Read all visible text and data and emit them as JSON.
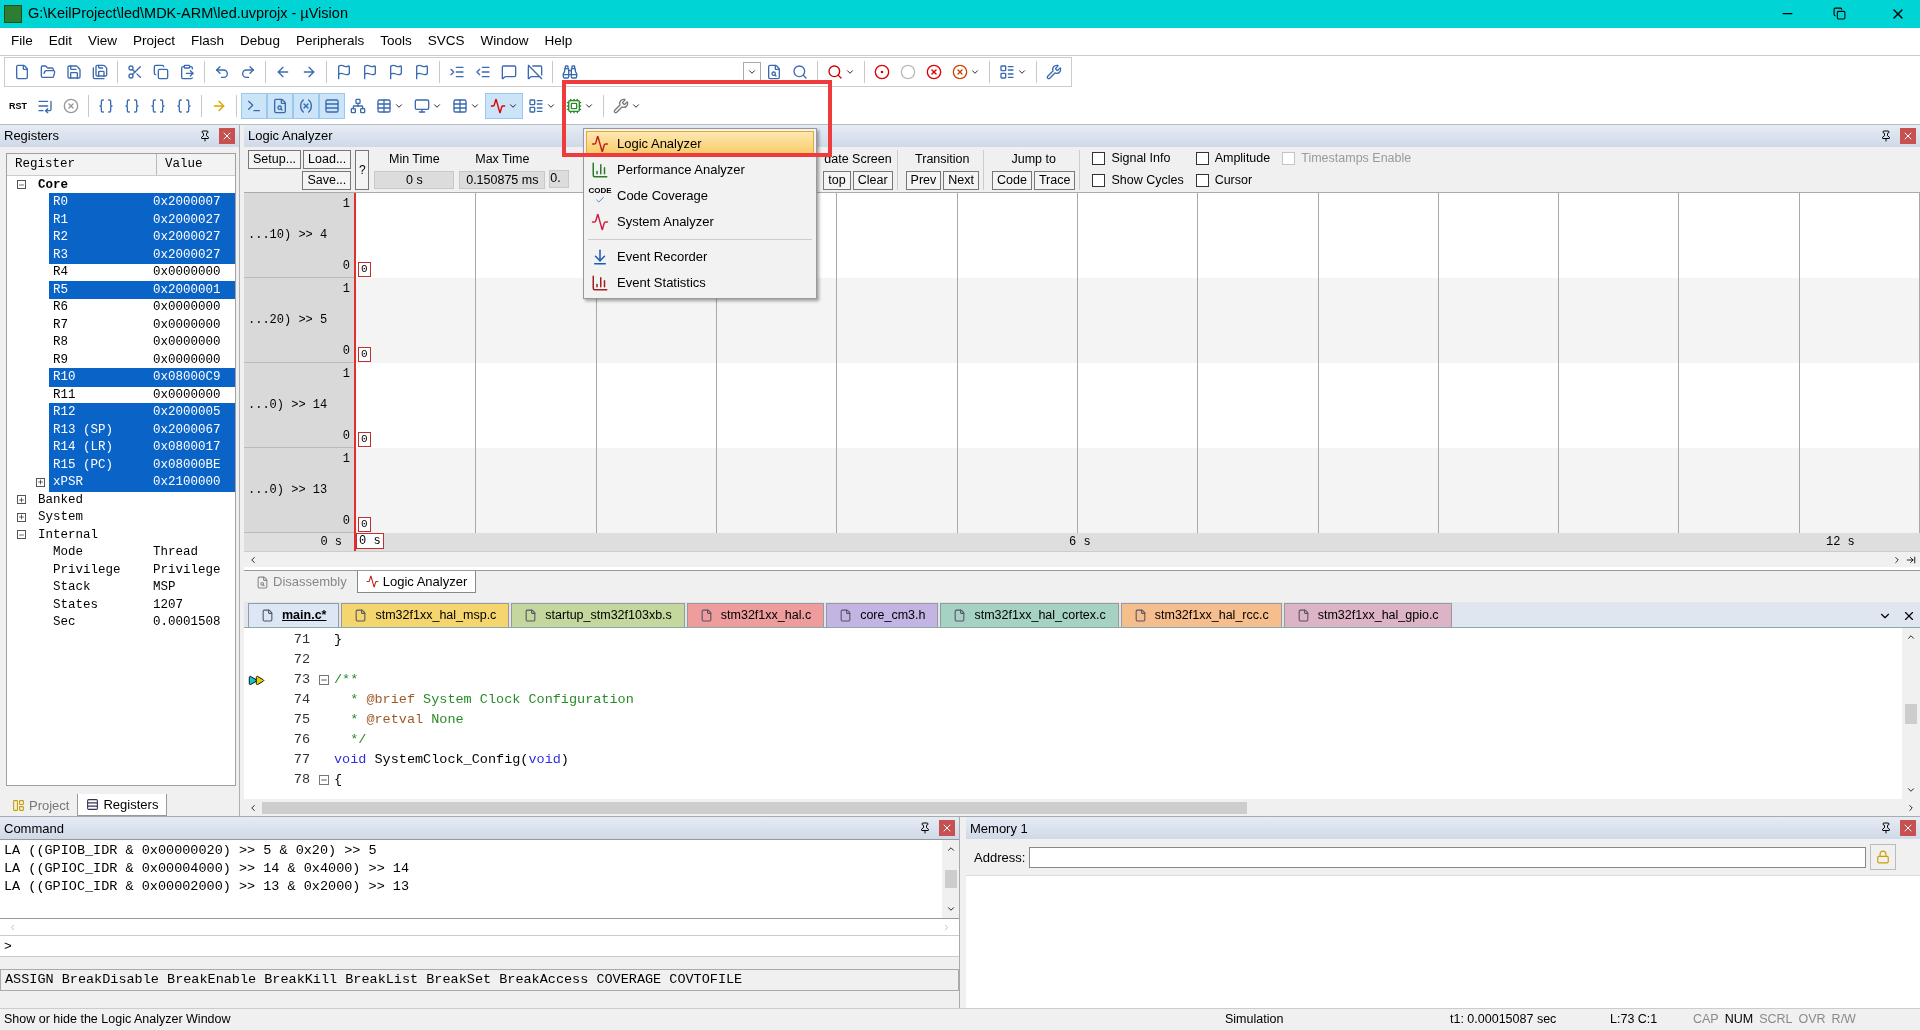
{
  "window": {
    "title": "G:\\KeilProject\\led\\MDK-ARM\\led.uvprojx - µVision"
  },
  "menu": [
    "File",
    "Edit",
    "View",
    "Project",
    "Flash",
    "Debug",
    "Peripherals",
    "Tools",
    "SVCS",
    "Window",
    "Help"
  ],
  "debug_toolbar": [
    {
      "label": "RST",
      "pressed": false
    },
    {
      "pressed": false
    },
    {
      "pressed": false
    },
    {
      "pressed": false
    },
    {
      "pressed": false
    },
    {
      "pressed": false
    },
    {
      "pressed": false
    },
    {
      "pressed": false
    },
    {
      "pressed": true
    },
    {
      "pressed": true
    },
    {
      "pressed": true
    },
    {
      "pressed": true
    },
    {
      "pressed": false
    },
    {
      "pressed": false
    },
    {
      "pressed": false
    },
    {
      "pressed": false
    },
    {
      "pressed": true
    },
    {
      "pressed": false
    },
    {
      "pressed": false
    },
    {
      "pressed": false
    }
  ],
  "registers": {
    "title": "Registers",
    "columns": [
      "Register",
      "Value"
    ],
    "groups": [
      {
        "name": "Core",
        "expanded": true,
        "children": [
          {
            "name": "R0",
            "value": "0x2000007",
            "selected": true,
            "kind": "leaf"
          },
          {
            "name": "R1",
            "value": "0x2000027",
            "selected": true,
            "kind": "leaf"
          },
          {
            "name": "R2",
            "value": "0x2000027",
            "selected": true,
            "kind": "leaf"
          },
          {
            "name": "R3",
            "value": "0x2000027",
            "selected": true,
            "kind": "leaf"
          },
          {
            "name": "R4",
            "value": "0x0000000",
            "selected": false,
            "kind": "leaf"
          },
          {
            "name": "R5",
            "value": "0x2000001",
            "selected": true,
            "kind": "leaf"
          },
          {
            "name": "R6",
            "value": "0x0000000",
            "selected": false,
            "kind": "leaf"
          },
          {
            "name": "R7",
            "value": "0x0000000",
            "selected": false,
            "kind": "leaf"
          },
          {
            "name": "R8",
            "value": "0x0000000",
            "selected": false,
            "kind": "leaf"
          },
          {
            "name": "R9",
            "value": "0x0000000",
            "selected": false,
            "kind": "leaf"
          },
          {
            "name": "R10",
            "value": "0x08000C9",
            "selected": true,
            "kind": "leaf"
          },
          {
            "name": "R11",
            "value": "0x0000000",
            "selected": false,
            "kind": "leaf"
          },
          {
            "name": "R12",
            "value": "0x2000005",
            "selected": true,
            "kind": "leaf"
          },
          {
            "name": "R13 (SP)",
            "value": "0x2000067",
            "selected": true,
            "kind": "leaf"
          },
          {
            "name": "R14 (LR)",
            "value": "0x0800017",
            "selected": true,
            "kind": "leaf"
          },
          {
            "name": "R15 (PC)",
            "value": "0x08000BE",
            "selected": true,
            "kind": "leaf"
          },
          {
            "name": "xPSR",
            "value": "0x2100000",
            "selected": true,
            "kind": "group"
          }
        ]
      },
      {
        "name": "Banked",
        "expanded": false
      },
      {
        "name": "System",
        "expanded": false
      },
      {
        "name": "Internal",
        "expanded": true,
        "children": [
          {
            "name": "Mode",
            "value": "Thread",
            "selected": false,
            "kind": "leaf"
          },
          {
            "name": "Privilege",
            "value": "Privilege",
            "selected": false,
            "kind": "leaf"
          },
          {
            "name": "Stack",
            "value": "MSP",
            "selected": false,
            "kind": "leaf"
          },
          {
            "name": "States",
            "value": "1207",
            "selected": false,
            "kind": "leaf"
          },
          {
            "name": "Sec",
            "value": "0.0001508",
            "selected": false,
            "kind": "leaf"
          }
        ]
      }
    ],
    "tabs": [
      {
        "label": "Project",
        "selected": false
      },
      {
        "label": "Registers",
        "selected": true
      }
    ]
  },
  "logic_analyzer": {
    "title": "Logic Analyzer",
    "buttons": {
      "setup": "Setup...",
      "load": "Load...",
      "save": "Save...",
      "help": "?"
    },
    "min_time": {
      "label": "Min Time",
      "value": "0 s"
    },
    "max_time": {
      "label": "Max Time",
      "value": "0.150875 ms"
    },
    "column_3": {
      "value": "0."
    },
    "update_screen": {
      "label": "date Screen",
      "buttons": [
        "top",
        "Clear"
      ]
    },
    "transition": {
      "label": "Transition",
      "buttons": [
        "Prev",
        "Next"
      ]
    },
    "jump_to": {
      "label": "Jump to",
      "buttons": [
        "Code",
        "Trace"
      ]
    },
    "options": [
      {
        "label": "Signal Info",
        "checked": false,
        "disabled": false
      },
      {
        "label": "Amplitude",
        "checked": false,
        "disabled": false
      },
      {
        "label": "Timestamps Enable",
        "checked": false,
        "disabled": true
      },
      {
        "label": "Show Cycles",
        "checked": false,
        "disabled": false
      },
      {
        "label": "Cursor",
        "checked": false,
        "disabled": false
      }
    ],
    "signals": [
      {
        "label": "...10) >> 4",
        "high": "1",
        "low": "0",
        "marker": "0"
      },
      {
        "label": "...20) >> 5",
        "high": "1",
        "low": "0",
        "marker": "0"
      },
      {
        "label": "...0) >> 14",
        "high": "1",
        "low": "0",
        "marker": "0"
      },
      {
        "label": "...0) >> 13",
        "high": "1",
        "low": "0",
        "marker": "0"
      }
    ],
    "time_axis": {
      "start": "0 s",
      "cursor": "0 s",
      "ticks": [
        "6 s",
        "12 s"
      ]
    }
  },
  "analysis_menu": {
    "items": [
      {
        "label": "Logic Analyzer",
        "highlighted": true,
        "separator_before": false
      },
      {
        "label": "Performance Analyzer",
        "highlighted": false,
        "separator_before": false
      },
      {
        "label": "Code Coverage",
        "icon_text": "CODE",
        "highlighted": false,
        "separator_before": false
      },
      {
        "label": "System Analyzer",
        "highlighted": false,
        "separator_before": false
      },
      {
        "label": "Event Recorder",
        "highlighted": false,
        "separator_before": true
      },
      {
        "label": "Event Statistics",
        "highlighted": false,
        "separator_before": false
      }
    ]
  },
  "view_tabs": [
    {
      "label": "Disassembly",
      "selected": false
    },
    {
      "label": "Logic Analyzer",
      "selected": true
    }
  ],
  "editor": {
    "tabs": [
      {
        "label": "main.c*",
        "selected": true,
        "color": "#dce6f4"
      },
      {
        "label": "stm32f1xx_hal_msp.c",
        "selected": false,
        "color": "#f5d56e"
      },
      {
        "label": "startup_stm32f103xb.s",
        "selected": false,
        "color": "#c4d79c"
      },
      {
        "label": "stm32f1xx_hal.c",
        "selected": false,
        "color": "#ee9c9c"
      },
      {
        "label": "core_cm3.h",
        "selected": false,
        "color": "#c4b4e4"
      },
      {
        "label": "stm32f1xx_hal_cortex.c",
        "selected": false,
        "color": "#a6d2c4"
      },
      {
        "label": "stm32f1xx_hal_rcc.c",
        "selected": false,
        "color": "#f6be8c"
      },
      {
        "label": "stm32f1xx_hal_gpio.c",
        "selected": false,
        "color": "#dcb4c6"
      }
    ],
    "lines": [
      {
        "number": "71",
        "current": false,
        "fold": false,
        "segments": [
          {
            "kind": "plain",
            "text": "}"
          }
        ]
      },
      {
        "number": "72",
        "current": false,
        "fold": false
      },
      {
        "number": "73",
        "current": true,
        "fold": true,
        "segments": [
          {
            "kind": "comment",
            "text": "/**"
          }
        ]
      },
      {
        "number": "74",
        "current": false,
        "fold": false,
        "segments": [
          {
            "kind": "comment",
            "text": "  * "
          },
          {
            "kind": "tag",
            "text": "@brief"
          },
          {
            "kind": "comment",
            "text": " System Clock Configuration"
          }
        ]
      },
      {
        "number": "75",
        "current": false,
        "fold": false,
        "segments": [
          {
            "kind": "comment",
            "text": "  * "
          },
          {
            "kind": "tag",
            "text": "@retval"
          },
          {
            "kind": "comment",
            "text": " None"
          }
        ]
      },
      {
        "number": "76",
        "current": false,
        "fold": false,
        "segments": [
          {
            "kind": "comment",
            "text": "  */"
          }
        ]
      },
      {
        "number": "77",
        "current": false,
        "fold": false,
        "segments": [
          {
            "kind": "keyword",
            "text": "void"
          },
          {
            "kind": "plain",
            "text": " SystemClock_Config("
          },
          {
            "kind": "keyword",
            "text": "void"
          },
          {
            "kind": "plain",
            "text": ")"
          }
        ]
      },
      {
        "number": "78",
        "current": false,
        "fold": true,
        "segments": [
          {
            "kind": "plain",
            "text": "{"
          }
        ]
      }
    ]
  },
  "command": {
    "title": "Command",
    "output": [
      "LA ((GPIOB_IDR & 0x00000020) >> 5 & 0x20) >> 5",
      "LA ((GPIOC_IDR & 0x00004000) >> 14 & 0x4000) >> 14",
      "LA ((GPIOC_IDR & 0x00002000) >> 13 & 0x2000) >> 13"
    ],
    "prompt": ">",
    "hint": "ASSIGN BreakDisable BreakEnable BreakKill BreakList BreakSet BreakAccess COVERAGE COVTOFILE"
  },
  "memory": {
    "title": "Memory 1",
    "address_label": "Address:"
  },
  "status_bar": {
    "message": "Show or hide the Logic Analyzer Window",
    "mode": "Simulation",
    "time": "t1: 0.00015087 sec",
    "position": "L:73 C:1",
    "indicators": [
      {
        "label": "CAP",
        "on": false
      },
      {
        "label": "NUM",
        "on": true
      },
      {
        "label": "SCRL",
        "on": false
      },
      {
        "label": "OVR",
        "on": false
      },
      {
        "label": "R/W",
        "on": false
      }
    ]
  }
}
